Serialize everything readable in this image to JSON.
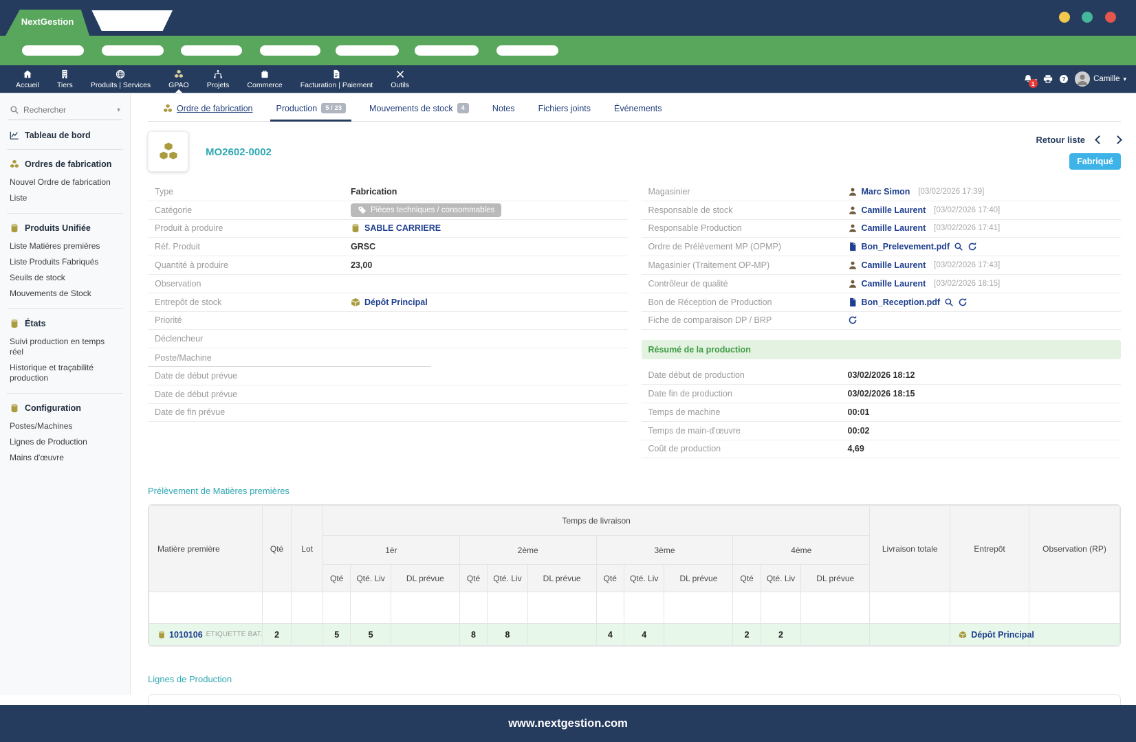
{
  "window": {
    "brand": "NextGestion",
    "footer_url": "www.nextgestion.com"
  },
  "colors": {
    "navy": "#263c5e",
    "green": "#58a75c",
    "teal": "#2fa8b3",
    "gold": "#ab9b3f",
    "link_blue": "#1e3f8f",
    "status_blue": "#3eb3e8",
    "summary_green": "#3f9c44"
  },
  "topnav": {
    "items": [
      {
        "label": "Accueil",
        "icon": "home"
      },
      {
        "label": "Tiers",
        "icon": "building"
      },
      {
        "label": "Produits | Services",
        "icon": "globe"
      },
      {
        "label": "GPAO",
        "icon": "cubes",
        "active": true
      },
      {
        "label": "Projets",
        "icon": "sitemap"
      },
      {
        "label": "Commerce",
        "icon": "briefcase"
      },
      {
        "label": "Facturation | Paiement",
        "icon": "invoice"
      },
      {
        "label": "Outils",
        "icon": "tools"
      }
    ],
    "notification_count": "1",
    "user_name": "Camille"
  },
  "sidebar": {
    "search_placeholder": "Rechercher",
    "dashboard_label": "Tableau de bord",
    "sections": [
      {
        "title": "Ordres de fabrication",
        "icon": "cubes",
        "items": [
          "Nouvel Ordre de fabrication",
          "Liste"
        ]
      },
      {
        "title": "Produits Unifiée",
        "icon": "db",
        "items": [
          "Liste Matières premières",
          "Liste Produits Fabriqués",
          "Seuils de stock",
          "Mouvements de Stock"
        ]
      },
      {
        "title": "États",
        "icon": "db",
        "items": [
          "Suivi production en temps réel",
          "Historique et traçabilité production"
        ]
      },
      {
        "title": "Configuration",
        "icon": "db",
        "items": [
          "Postes/Machines",
          "Lignes de Production",
          "Mains d'œuvre"
        ]
      }
    ]
  },
  "tabs": [
    {
      "label": "Ordre de fabrication",
      "icon": "cubes",
      "style": "link"
    },
    {
      "label": "Production",
      "badge": "5 / 23",
      "active": true
    },
    {
      "label": "Mouvements de stock",
      "badge": "4"
    },
    {
      "label": "Notes"
    },
    {
      "label": "Fichiers joints"
    },
    {
      "label": "Événements"
    }
  ],
  "order": {
    "title": "MO2602-0002",
    "back_label": "Retour liste",
    "status": "Fabriqué"
  },
  "details_left": [
    {
      "label": "Type",
      "type": "text",
      "value": "Fabrication"
    },
    {
      "label": "Catégorie",
      "type": "pill",
      "value": "Pièces techniques / consommables"
    },
    {
      "label": "Produit à produire",
      "type": "link",
      "icon": "db",
      "value": "SABLE CARRIERE"
    },
    {
      "label": "Réf. Produit",
      "type": "text",
      "value": "GRSC"
    },
    {
      "label": "Quantité à produire",
      "type": "text",
      "value": "23,00"
    },
    {
      "label": "Observation",
      "type": "empty"
    },
    {
      "label": "Entrepôt de stock",
      "type": "link",
      "icon": "box",
      "value": "Dépôt Principal"
    },
    {
      "label": "Priorité",
      "type": "empty"
    },
    {
      "label": "Déclencheur",
      "type": "empty"
    },
    {
      "label": "Poste/Machine",
      "type": "empty",
      "short": true
    },
    {
      "label": "Date de début prévue",
      "type": "empty"
    },
    {
      "label": "Date de début prévue",
      "type": "empty"
    },
    {
      "label": "Date de fin prévue",
      "type": "empty"
    }
  ],
  "details_right": [
    {
      "label": "Magasinier",
      "type": "person",
      "value": "Marc Simon",
      "time": "[03/02/2026 17:39]"
    },
    {
      "label": "Responsable de stock",
      "type": "person",
      "value": "Camille Laurent",
      "time": "[03/02/2026 17:40]"
    },
    {
      "label": "Responsable Production",
      "type": "person",
      "value": "Camille Laurent",
      "time": "[03/02/2026 17:41]"
    },
    {
      "label": "Ordre de Prélèvement MP (OPMP)",
      "type": "pdf",
      "value": "Bon_Prelevement.pdf"
    },
    {
      "label": "Magasinier (Traitement OP-MP)",
      "type": "person",
      "value": "Camille Laurent",
      "time": "[03/02/2026 17:43]"
    },
    {
      "label": "Contrôleur de qualité",
      "type": "person",
      "value": "Camille Laurent",
      "time": "[03/02/2026 18:15]"
    },
    {
      "label": "Bon de Réception de Production",
      "type": "pdf",
      "value": "Bon_Reception.pdf"
    },
    {
      "label": "Fiche de comparaison DP / BRP",
      "type": "refresh"
    }
  ],
  "production_summary": {
    "title": "Résumé de la production",
    "rows": [
      {
        "label": "Date début de production",
        "value": "03/02/2026 18:12"
      },
      {
        "label": "Date fin de production",
        "value": "03/02/2026 18:15"
      },
      {
        "label": "Temps de machine",
        "value": "00:01"
      },
      {
        "label": "Temps de main-d'œuvre",
        "value": "00:02"
      },
      {
        "label": "Coût de production",
        "value": "4,69"
      }
    ]
  },
  "materials": {
    "section_title": "Prélèvement de Matières premières",
    "col_material": "Matière première",
    "col_qty": "Qté",
    "col_lot": "Lot",
    "group_title": "Temps de livraison",
    "deliveries": [
      "1èr",
      "2ème",
      "3ème",
      "4ème"
    ],
    "sub_cols": [
      "Qté",
      "Qté. Liv",
      "DL prévue"
    ],
    "col_total": "Livraison totale",
    "col_warehouse": "Entrepôt",
    "col_observation": "Observation (RP)",
    "rows": [
      {
        "code": "1010106",
        "name": "ETIQUETTE BAT...",
        "qty": "2",
        "lot": "",
        "cells": [
          [
            "5",
            "5",
            ""
          ],
          [
            "8",
            "8",
            ""
          ],
          [
            "4",
            "4",
            ""
          ],
          [
            "2",
            "2",
            ""
          ]
        ],
        "total": "",
        "warehouse": "Dépôt Principal",
        "observation": ""
      }
    ]
  },
  "lines": {
    "section_title": "Lignes de Production"
  }
}
